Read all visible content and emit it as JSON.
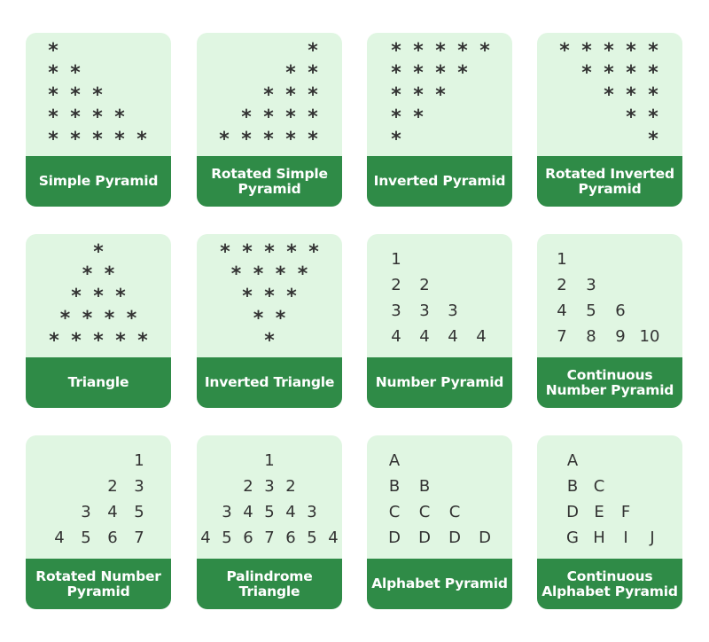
{
  "colors": {
    "card_background": "#e0f6e2",
    "label_band": "#2f8b47",
    "label_text": "#ffffff",
    "pattern_text": "#333333"
  },
  "cards": [
    {
      "label": "Simple Pyramid",
      "align": "left",
      "rows": [
        [
          "*"
        ],
        [
          "*",
          "*"
        ],
        [
          "*",
          "*",
          "*"
        ],
        [
          "*",
          "*",
          "*",
          "*"
        ],
        [
          "*",
          "*",
          "*",
          "*",
          "*"
        ]
      ]
    },
    {
      "label": "Rotated Simple Pyramid",
      "align": "right",
      "rows": [
        [
          "*"
        ],
        [
          "*",
          "*"
        ],
        [
          "*",
          "*",
          "*"
        ],
        [
          "*",
          "*",
          "*",
          "*"
        ],
        [
          "*",
          "*",
          "*",
          "*",
          "*"
        ]
      ]
    },
    {
      "label": "Inverted Pyramid",
      "align": "left",
      "rows": [
        [
          "*",
          "*",
          "*",
          "*",
          "*"
        ],
        [
          "*",
          "*",
          "*",
          "*"
        ],
        [
          "*",
          "*",
          "*"
        ],
        [
          "*",
          "*"
        ],
        [
          "*"
        ]
      ]
    },
    {
      "label": "Rotated Inverted Pyramid",
      "align": "right",
      "rows": [
        [
          "*",
          "*",
          "*",
          "*",
          "*"
        ],
        [
          "*",
          "*",
          "*",
          "*"
        ],
        [
          "*",
          "*",
          "*"
        ],
        [
          "*",
          "*"
        ],
        [
          "*"
        ]
      ]
    },
    {
      "label": "Triangle",
      "align": "center",
      "rows": [
        [
          "*"
        ],
        [
          "*",
          "*"
        ],
        [
          "*",
          "*",
          "*"
        ],
        [
          "*",
          "*",
          "*",
          "*"
        ],
        [
          "*",
          "*",
          "*",
          "*",
          "*"
        ]
      ]
    },
    {
      "label": "Inverted Triangle",
      "align": "center",
      "rows": [
        [
          "*",
          "*",
          "*",
          "*",
          "*"
        ],
        [
          "*",
          "*",
          "*",
          "*"
        ],
        [
          "*",
          "*",
          "*"
        ],
        [
          "*",
          "*"
        ],
        [
          "*"
        ]
      ]
    },
    {
      "label": "Number Pyramid",
      "align": "left",
      "rows": [
        [
          "1"
        ],
        [
          "2",
          "2"
        ],
        [
          "3",
          "3",
          "3"
        ],
        [
          "4",
          "4",
          "4",
          "4"
        ]
      ]
    },
    {
      "label": "Continuous Number Pyramid",
      "align": "left",
      "rows": [
        [
          "1"
        ],
        [
          "2",
          "3"
        ],
        [
          "4",
          "5",
          "6"
        ],
        [
          "7",
          "8",
          "9",
          "10"
        ]
      ]
    },
    {
      "label": "Rotated Number Pyramid",
      "align": "right",
      "rows": [
        [
          "1"
        ],
        [
          "2",
          "3"
        ],
        [
          "3",
          "4",
          "5"
        ],
        [
          "4",
          "5",
          "6",
          "7"
        ]
      ]
    },
    {
      "label": "Palindrome Triangle",
      "align": "center",
      "rows": [
        [
          "1"
        ],
        [
          "2",
          "3",
          "2"
        ],
        [
          "3",
          "4",
          "5",
          "4",
          "3"
        ],
        [
          "4",
          "5",
          "6",
          "7",
          "6",
          "5",
          "4"
        ]
      ]
    },
    {
      "label": "Alphabet Pyramid",
      "align": "left",
      "rows": [
        [
          "A"
        ],
        [
          "B",
          "B"
        ],
        [
          "C",
          "C",
          "C"
        ],
        [
          "D",
          "D",
          "D",
          "D"
        ]
      ]
    },
    {
      "label": "Continuous Alphabet Pyramid",
      "align": "left",
      "rows": [
        [
          "A"
        ],
        [
          "B",
          "C"
        ],
        [
          "D",
          "E",
          "F"
        ],
        [
          "G",
          "H",
          "I",
          "J"
        ]
      ]
    }
  ]
}
